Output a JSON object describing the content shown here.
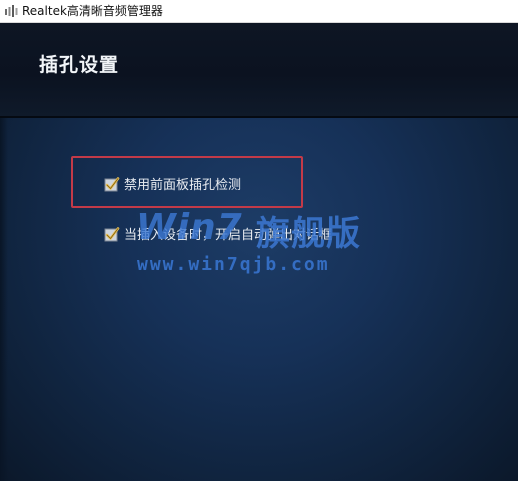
{
  "window": {
    "title": "Realtek高清晰音频管理器",
    "icon": "speaker-bars-icon"
  },
  "header": {
    "title": "插孔设置"
  },
  "options": [
    {
      "label": "禁用前面板插孔检测",
      "checked": true
    },
    {
      "label": "当插入设备时，开启自动弹出对话框",
      "checked": true
    }
  ],
  "watermark": {
    "logo": "Win7",
    "logo_cn": "旗舰版",
    "url": "www.win7qjb.com"
  },
  "colors": {
    "highlight": "#c33a48",
    "checkmark": "#e8c25a",
    "panel": "#163158"
  }
}
